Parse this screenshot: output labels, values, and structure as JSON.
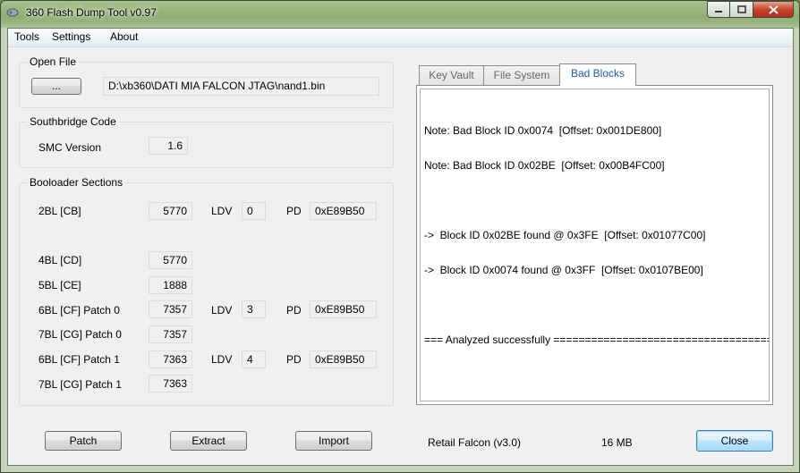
{
  "window": {
    "title": "360 Flash Dump Tool  v0.97"
  },
  "menu": [
    "Tools",
    "Settings",
    "About"
  ],
  "open_file": {
    "group_title": "Open File",
    "browse_label": "...",
    "path": "D:\\xb360\\DATI MIA FALCON JTAG\\nand1.bin"
  },
  "southbridge": {
    "group_title": "Southbridge Code",
    "smc_label": "SMC Version",
    "smc_value": "1.6"
  },
  "bootloader": {
    "group_title": "Booloader Sections",
    "ldv_label": "LDV",
    "pd_label": "PD",
    "rows": [
      {
        "label": "2BL [CB]",
        "value": "5770",
        "ldv": "0",
        "pd": "0xE89B50"
      },
      {
        "label": "4BL [CD]",
        "value": "5770"
      },
      {
        "label": "5BL [CE]",
        "value": "1888"
      },
      {
        "label": "6BL [CF] Patch 0",
        "value": "7357",
        "ldv": "3",
        "pd": "0xE89B50"
      },
      {
        "label": "7BL [CG] Patch 0",
        "value": "7357"
      },
      {
        "label": "6BL [CF] Patch 1",
        "value": "7363",
        "ldv": "4",
        "pd": "0xE89B50"
      },
      {
        "label": "7BL [CG] Patch 1",
        "value": "7363"
      }
    ]
  },
  "tabs": [
    {
      "label": "Key Vault",
      "active": false
    },
    {
      "label": "File System",
      "active": false
    },
    {
      "label": "Bad Blocks",
      "active": true
    }
  ],
  "log": [
    "Note: Bad Block ID 0x0074  [Offset: 0x001DE800]",
    "Note: Bad Block ID 0x02BE  [Offset: 0x00B4FC00]",
    "",
    "->  Block ID 0x02BE found @ 0x3FE  [Offset: 0x01077C00]",
    "->  Block ID 0x0074 found @ 0x3FF  [Offset: 0x0107BE00]",
    "",
    "=== Analyzed successfully =========================================="
  ],
  "buttons": {
    "patch": "Patch",
    "extract": "Extract",
    "import": "Import",
    "close": "Close"
  },
  "status": {
    "console": "Retail Falcon (v3.0)",
    "size": "16 MB"
  },
  "colors": {
    "active_tab_text": "#1a5fb4",
    "close_caption": "#c8442b"
  }
}
